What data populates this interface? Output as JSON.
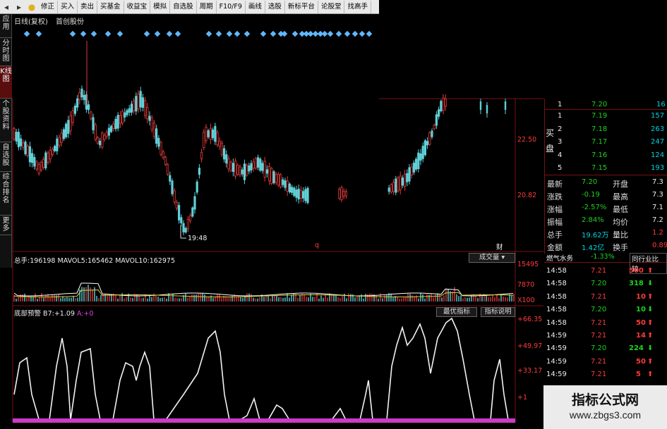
{
  "toolbar": {
    "items": [
      "修正",
      "买入",
      "卖出",
      "买基金",
      "收益宝",
      "模拟",
      "自选股",
      "周期",
      "F10/F9",
      "画线",
      "选股",
      "新标平台",
      "论股堂",
      "找高手"
    ]
  },
  "leftnav": {
    "tabs": [
      "应用",
      "分时图",
      "K线图",
      "个股资料",
      "自选股",
      "综合排名",
      "更多"
    ]
  },
  "chart_header": {
    "period": "日线(复权)",
    "stock": "首创股份"
  },
  "price_axis": {
    "ticks": [
      "22.50",
      "20.82"
    ],
    "low_marker": "19:48",
    "red_q": "q",
    "cai": "财"
  },
  "volume": {
    "label_prefix": "总手:",
    "total": "196198",
    "ma5_label": "MAVOL5:",
    "ma5": "165462",
    "ma10_label": "MAVOL10:",
    "ma10": "162975",
    "dropdown": "成交量",
    "axis": [
      "15495",
      "7870",
      "X100"
    ]
  },
  "indicator": {
    "name": "底部预警",
    "b7_label": "B7:",
    "b7": "+1.09",
    "a_label": "A:",
    "a": "+0",
    "btn_best": "最优指标",
    "btn_help": "指标说明",
    "axis": [
      "+66.35",
      "+49.97",
      "+33.17",
      "+1"
    ]
  },
  "orderbook": {
    "sell_label": "买盘",
    "top_row": {
      "level": "1",
      "price": "7.20",
      "vol": "16"
    },
    "buy_rows": [
      {
        "level": "1",
        "price": "7.19",
        "vol": "157"
      },
      {
        "level": "2",
        "price": "7.18",
        "vol": "263"
      },
      {
        "level": "3",
        "price": "7.17",
        "vol": "247"
      },
      {
        "level": "4",
        "price": "7.16",
        "vol": "124"
      },
      {
        "level": "5",
        "price": "7.15",
        "vol": "193"
      }
    ],
    "stats": [
      {
        "k1": "最新",
        "v1": "7.20",
        "k2": "开盘",
        "v2": "7.3"
      },
      {
        "k1": "涨跌",
        "v1": "-0.19",
        "k2": "最高",
        "v2": "7.3"
      },
      {
        "k1": "涨幅",
        "v1": "-2.57%",
        "k2": "最低",
        "v2": "7.1"
      },
      {
        "k1": "振幅",
        "v1": "2.84%",
        "k2": "均价",
        "v2": "7.2"
      },
      {
        "k1": "总手",
        "v1": "19.62万",
        "k2": "量比",
        "v2": "1.2"
      },
      {
        "k1": "金额",
        "v1": "1.42亿",
        "k2": "换手",
        "v2": "0.89"
      }
    ]
  },
  "ticks": {
    "sector": "燃气水务",
    "sector_change": "-1.33%",
    "compare": "同行业比较",
    "rows": [
      {
        "time": "14:58",
        "price": "7.21",
        "vol": "500",
        "dir": "up"
      },
      {
        "time": "14:58",
        "price": "7.20",
        "vol": "318",
        "dir": "down"
      },
      {
        "time": "14:58",
        "price": "7.21",
        "vol": "10",
        "dir": "up"
      },
      {
        "time": "14:58",
        "price": "7.20",
        "vol": "10",
        "dir": "down"
      },
      {
        "time": "14:58",
        "price": "7.21",
        "vol": "50",
        "dir": "up"
      },
      {
        "time": "14:59",
        "price": "7.21",
        "vol": "14",
        "dir": "up"
      },
      {
        "time": "14:59",
        "price": "7.20",
        "vol": "224",
        "dir": "down"
      },
      {
        "time": "14:59",
        "price": "7.21",
        "vol": "50",
        "dir": "up"
      },
      {
        "time": "14:59",
        "price": "7.21",
        "vol": "5",
        "dir": "up"
      }
    ]
  },
  "watermark": {
    "title": "指标公式网",
    "url": "www.zbgs3.com"
  },
  "colors": {
    "up": "#ff3b3b",
    "down": "#1cd41c",
    "ma_dot": "#5fb8ff",
    "pink_bar": "#c83cc8"
  }
}
